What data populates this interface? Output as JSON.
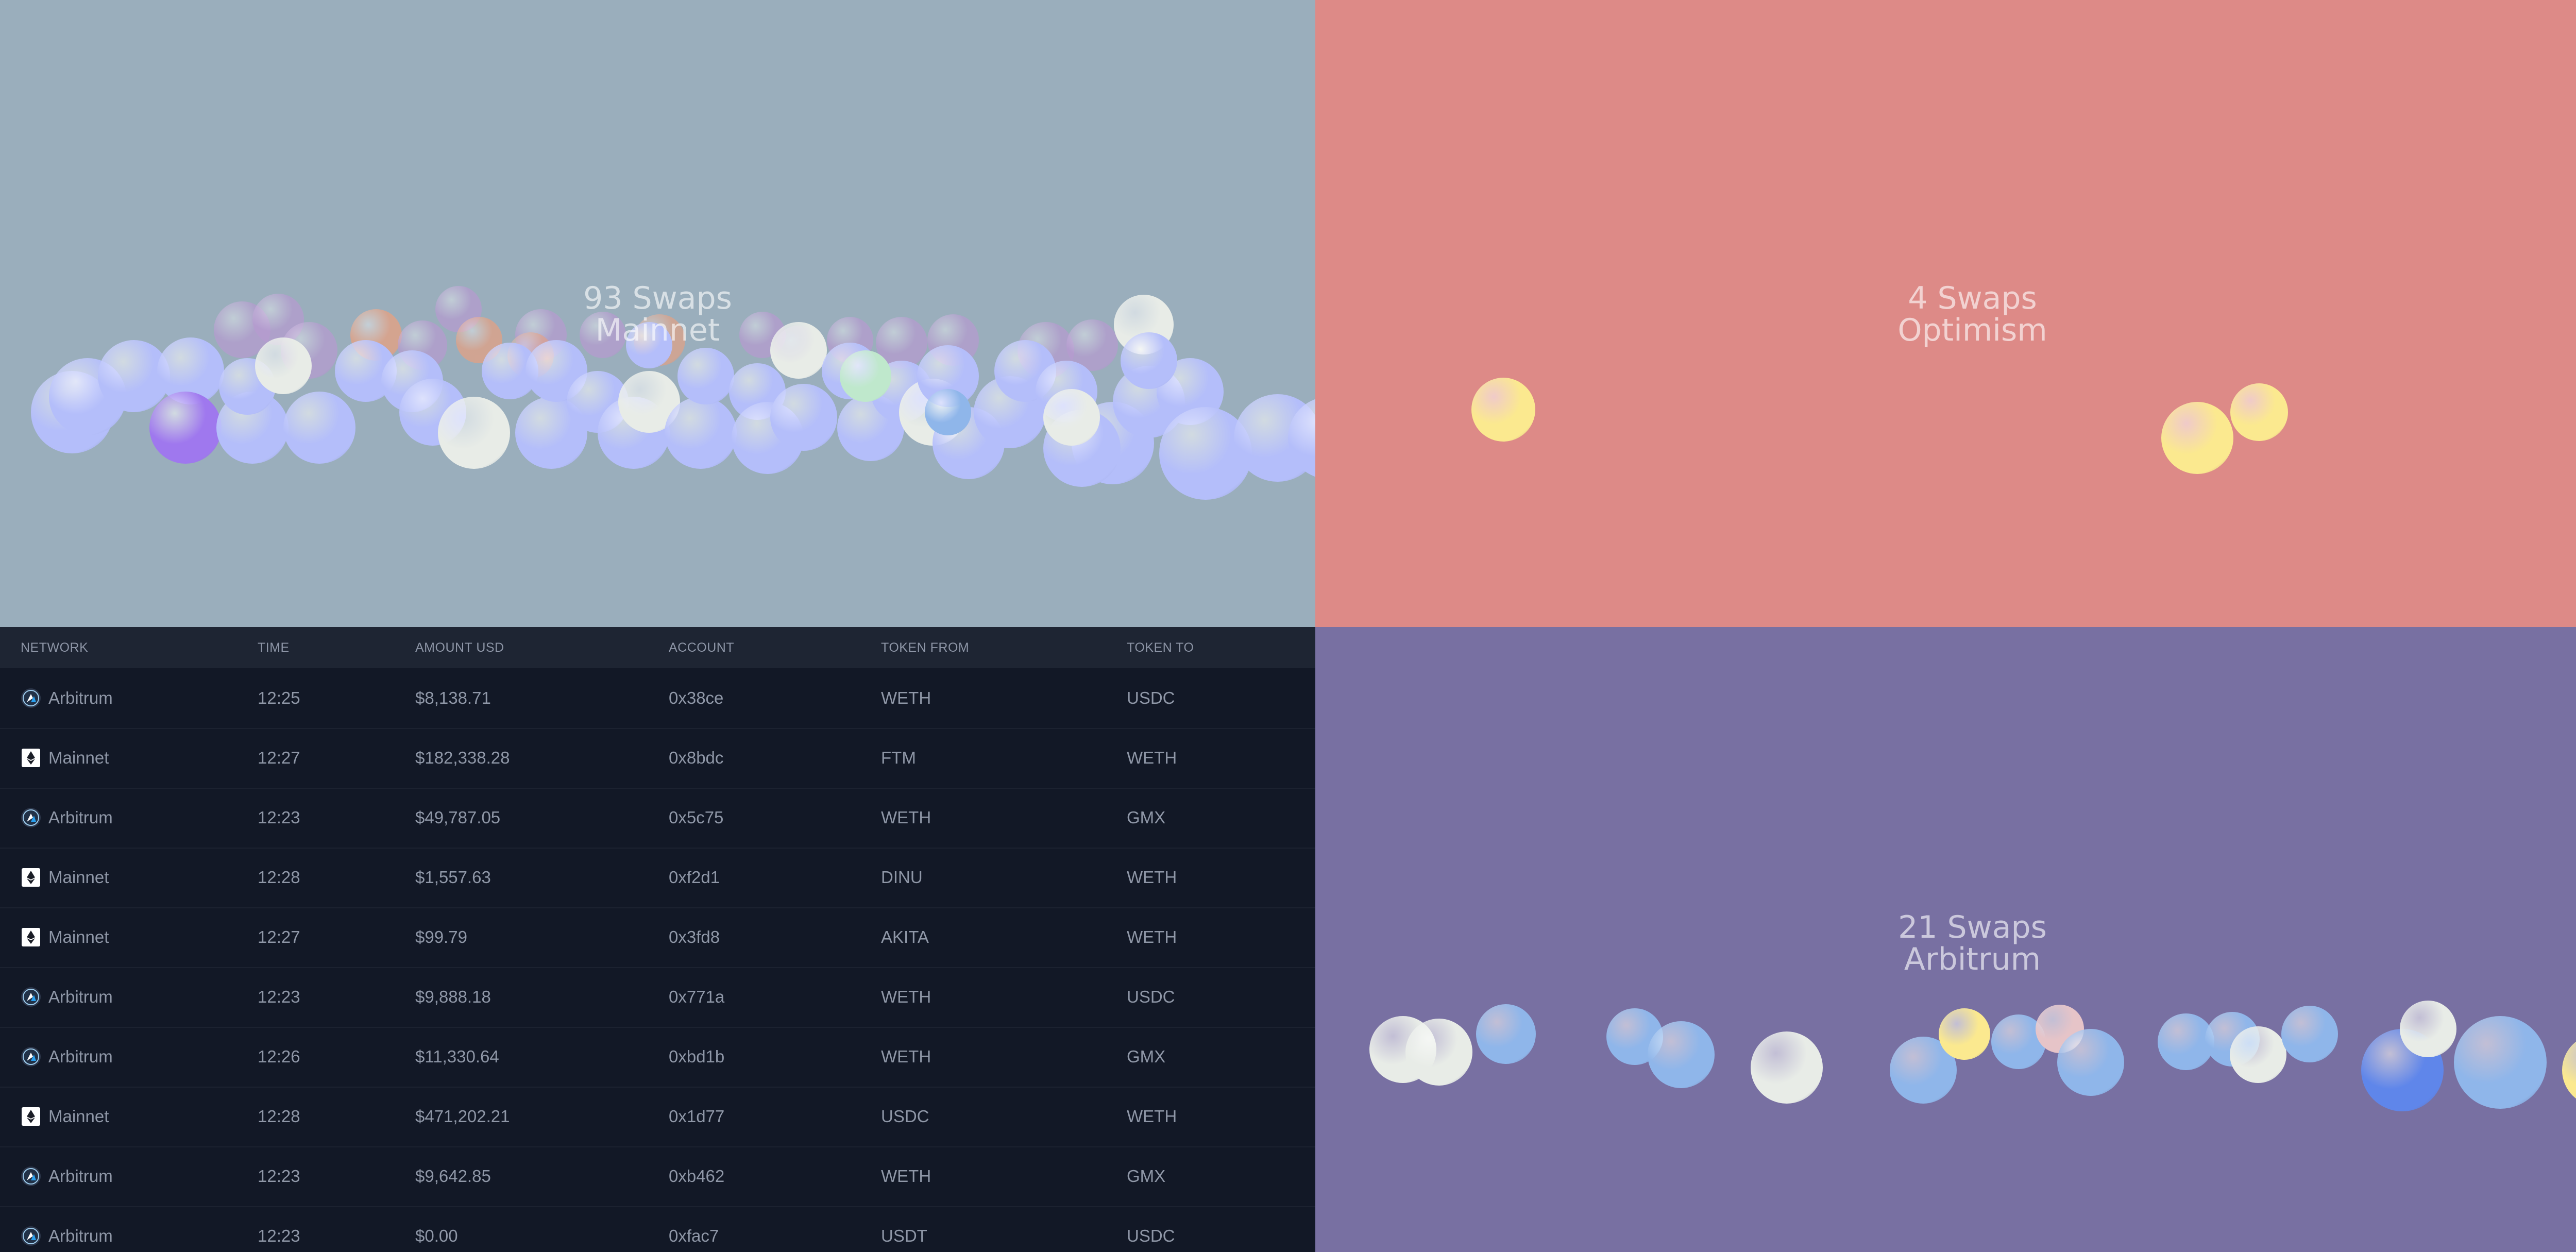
{
  "panels": {
    "mainnet": {
      "count_label": "93 Swaps",
      "network_label": "Mainnet",
      "background": "#9aaebc"
    },
    "optimism": {
      "count_label": "4 Swaps",
      "network_label": "Optimism",
      "background": "#dd8a87"
    },
    "arbitrum": {
      "count_label": "21 Swaps",
      "network_label": "Arbitrum",
      "background": "#7870a2"
    }
  },
  "table": {
    "headers": {
      "network": "Network",
      "time": "Time",
      "amount": "Amount USD",
      "account": "Account",
      "token_from": "Token From",
      "token_to": "Token To"
    },
    "rows": [
      {
        "network": "Arbitrum",
        "icon": "arbitrum-icon",
        "time": "12:25",
        "amount": "$8,138.71",
        "account": "0x38ce",
        "token_from": "WETH",
        "token_to": "USDC"
      },
      {
        "network": "Mainnet",
        "icon": "ethereum-icon",
        "time": "12:27",
        "amount": "$182,338.28",
        "account": "0x8bdc",
        "token_from": "FTM",
        "token_to": "WETH"
      },
      {
        "network": "Arbitrum",
        "icon": "arbitrum-icon",
        "time": "12:23",
        "amount": "$49,787.05",
        "account": "0x5c75",
        "token_from": "WETH",
        "token_to": "GMX"
      },
      {
        "network": "Mainnet",
        "icon": "ethereum-icon",
        "time": "12:28",
        "amount": "$1,557.63",
        "account": "0xf2d1",
        "token_from": "DINU",
        "token_to": "WETH"
      },
      {
        "network": "Mainnet",
        "icon": "ethereum-icon",
        "time": "12:27",
        "amount": "$99.79",
        "account": "0x3fd8",
        "token_from": "AKITA",
        "token_to": "WETH"
      },
      {
        "network": "Arbitrum",
        "icon": "arbitrum-icon",
        "time": "12:23",
        "amount": "$9,888.18",
        "account": "0x771a",
        "token_from": "WETH",
        "token_to": "USDC"
      },
      {
        "network": "Arbitrum",
        "icon": "arbitrum-icon",
        "time": "12:26",
        "amount": "$11,330.64",
        "account": "0xbd1b",
        "token_from": "WETH",
        "token_to": "GMX"
      },
      {
        "network": "Mainnet",
        "icon": "ethereum-icon",
        "time": "12:28",
        "amount": "$471,202.21",
        "account": "0x1d77",
        "token_from": "USDC",
        "token_to": "WETH"
      },
      {
        "network": "Arbitrum",
        "icon": "arbitrum-icon",
        "time": "12:23",
        "amount": "$9,642.85",
        "account": "0xb462",
        "token_from": "WETH",
        "token_to": "GMX"
      },
      {
        "network": "Arbitrum",
        "icon": "arbitrum-icon",
        "time": "12:23",
        "amount": "$0.00",
        "account": "0xfac7",
        "token_from": "USDT",
        "token_to": "USDC"
      }
    ]
  },
  "colors": {
    "table_background": "#121826",
    "table_header_background": "#1e2533",
    "table_text": "#8f97a7",
    "bubble_weth": "#b4befa",
    "bubble_usdc": "#8fb6ea",
    "bubble_usdt": "#e8ece7",
    "bubble_yellow": "#fbe98f"
  }
}
